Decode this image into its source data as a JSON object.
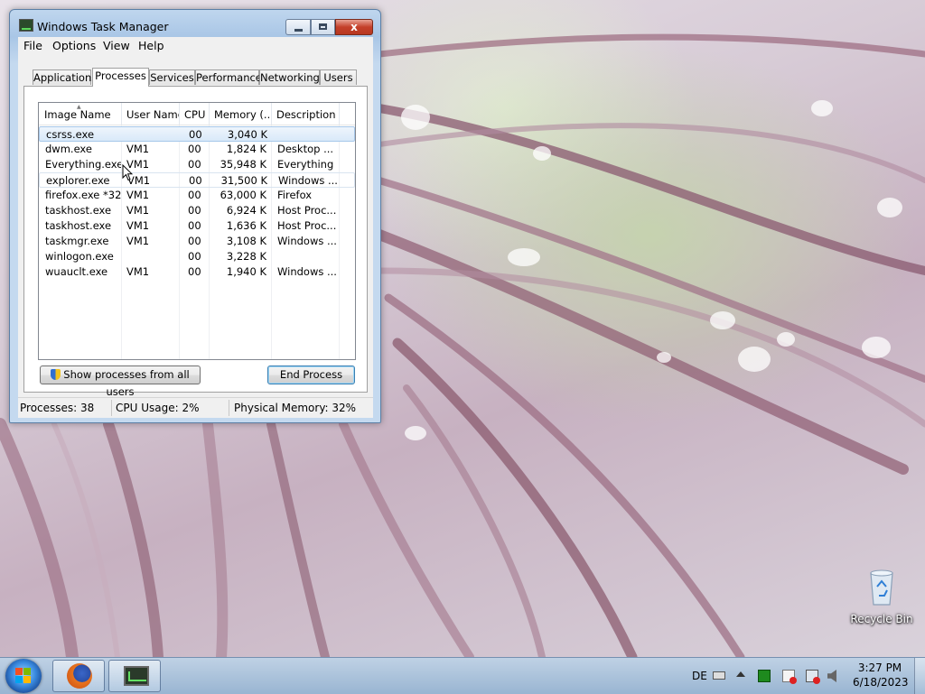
{
  "window": {
    "title": "Windows Task Manager",
    "close_label": "x",
    "menu": [
      "File",
      "Options",
      "View",
      "Help"
    ],
    "tabs": [
      "Applications",
      "Processes",
      "Services",
      "Performance",
      "Networking",
      "Users"
    ],
    "active_tab": "Processes",
    "columns": [
      "Image Name",
      "User Name",
      "CPU",
      "Memory (...",
      "Description"
    ],
    "rows": [
      {
        "image": "csrss.exe",
        "user": "",
        "cpu": "00",
        "memory": "3,040 K",
        "desc": ""
      },
      {
        "image": "dwm.exe",
        "user": "VM1",
        "cpu": "00",
        "memory": "1,824 K",
        "desc": "Desktop ..."
      },
      {
        "image": "Everything.exe",
        "user": "VM1",
        "cpu": "00",
        "memory": "35,948 K",
        "desc": "Everything"
      },
      {
        "image": "explorer.exe",
        "user": "VM1",
        "cpu": "00",
        "memory": "31,500 K",
        "desc": "Windows ..."
      },
      {
        "image": "firefox.exe *32",
        "user": "VM1",
        "cpu": "00",
        "memory": "63,000 K",
        "desc": "Firefox"
      },
      {
        "image": "taskhost.exe",
        "user": "VM1",
        "cpu": "00",
        "memory": "6,924 K",
        "desc": "Host Proc..."
      },
      {
        "image": "taskhost.exe",
        "user": "VM1",
        "cpu": "00",
        "memory": "1,636 K",
        "desc": "Host Proc..."
      },
      {
        "image": "taskmgr.exe",
        "user": "VM1",
        "cpu": "00",
        "memory": "3,108 K",
        "desc": "Windows ..."
      },
      {
        "image": "winlogon.exe",
        "user": "",
        "cpu": "00",
        "memory": "3,228 K",
        "desc": ""
      },
      {
        "image": "wuauclt.exe",
        "user": "VM1",
        "cpu": "00",
        "memory": "1,940 K",
        "desc": "Windows ..."
      }
    ],
    "selected_row": "csrss.exe",
    "hover_row": "explorer.exe",
    "buttons": {
      "show_all": "Show processes from all users",
      "end_process": "End Process"
    },
    "status": {
      "processes": "Processes: 38",
      "cpu": "CPU Usage: 2%",
      "memory": "Physical Memory: 32%"
    }
  },
  "desktop": {
    "recycle_bin_label": "Recycle Bin"
  },
  "taskbar": {
    "language": "DE",
    "time": "3:27 PM",
    "date": "6/18/2023",
    "pinned": [
      "firefox-icon",
      "task-manager-icon"
    ]
  },
  "colors": {
    "selection": "#d9e9f9",
    "taskbar": "#a9c3dd",
    "window_frame": "#bfd6ee"
  }
}
